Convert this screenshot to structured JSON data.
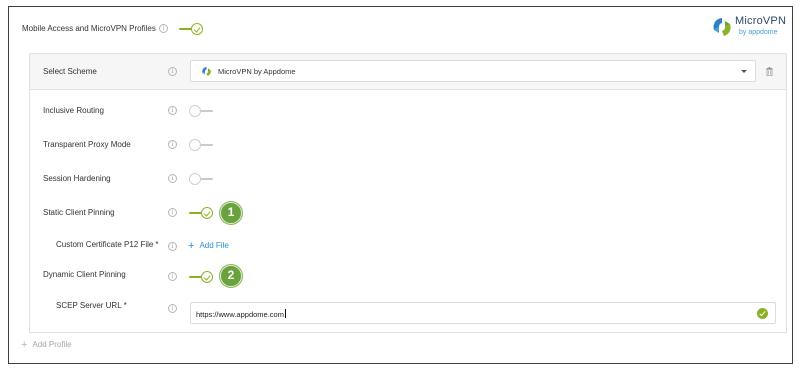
{
  "top": {
    "label": "Mobile Access and MicroVPN Profiles",
    "toggle_on": true
  },
  "logo": {
    "title": "MicroVPN",
    "subtitle": "by appdome"
  },
  "scheme": {
    "label": "Select Scheme",
    "selected": "MicroVPN by Appdome"
  },
  "rows": {
    "inclusive_routing": {
      "label": "Inclusive Routing",
      "on": false
    },
    "transparent_proxy": {
      "label": "Transparent Proxy Mode",
      "on": false
    },
    "session_hardening": {
      "label": "Session Hardening",
      "on": false
    },
    "static_pinning": {
      "label": "Static Client Pinning",
      "on": true,
      "badge": "1"
    },
    "custom_cert": {
      "label": "Custom Certificate P12 File",
      "required_mark": "*",
      "action": "Add File"
    },
    "dynamic_pinning": {
      "label": "Dynamic Client Pinning",
      "on": true,
      "badge": "2"
    },
    "scep": {
      "label": "SCEP Server URL",
      "required_mark": "*",
      "value": "https://www.appdome.com"
    }
  },
  "footer": {
    "add_profile": "Add Profile"
  },
  "colors": {
    "accent_green": "#8cb124",
    "badge_green": "#6aa33d",
    "link_blue": "#2c8fd4"
  }
}
